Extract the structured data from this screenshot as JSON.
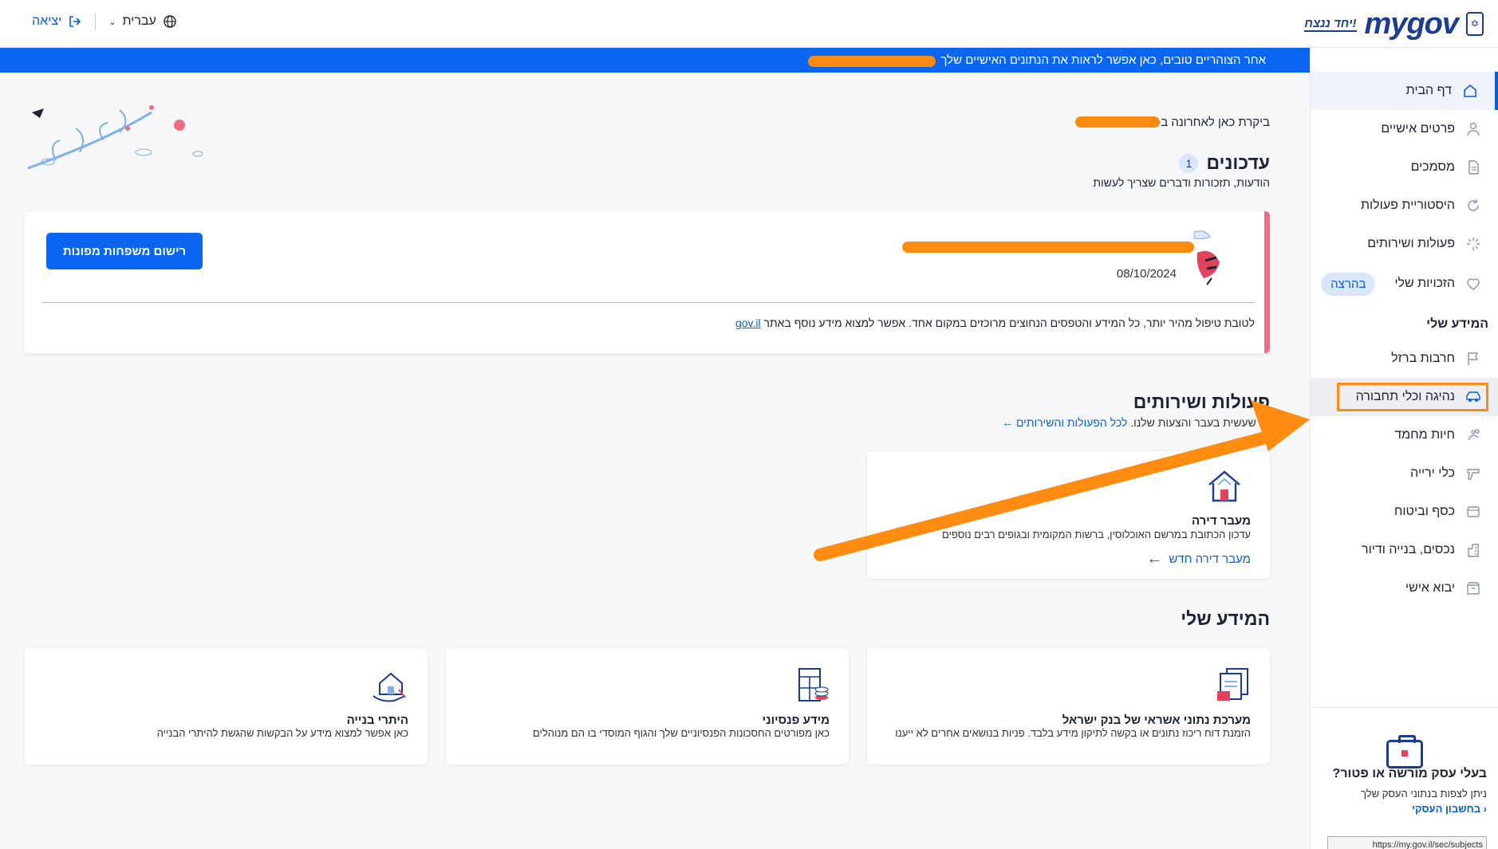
{
  "header": {
    "logo_text": "mygov",
    "slogan": "יחד ננצח!",
    "exit_label": "יציאה",
    "language_label": "עברית"
  },
  "banner": {
    "text": "אחר הצוהריים טובים,  כאן אפשר לראות את הנתונים האישיים שלך"
  },
  "sidebar": {
    "items": [
      {
        "label": "דף הבית",
        "icon": "home-icon"
      },
      {
        "label": "פרטים אישיים",
        "icon": "person-icon"
      },
      {
        "label": "מסמכים",
        "icon": "document-icon"
      },
      {
        "label": "היסטוריית פעולות",
        "icon": "history-icon"
      },
      {
        "label": "פעולות ושירותים",
        "icon": "services-icon"
      },
      {
        "label": "הזכויות שלי",
        "icon": "heart-icon",
        "tag": "בהרצה"
      }
    ],
    "section_title": "המידע שלי",
    "info_items": [
      {
        "label": "חרבות ברזל",
        "icon": "flag-icon"
      },
      {
        "label": "נהיגה וכלי תחבורה",
        "icon": "car-icon"
      },
      {
        "label": "חיות מחמד",
        "icon": "pet-icon"
      },
      {
        "label": "כלי ירייה",
        "icon": "gun-icon"
      },
      {
        "label": "כסף וביטוח",
        "icon": "money-icon"
      },
      {
        "label": "נכסים, בנייה ודיור",
        "icon": "building-icon"
      },
      {
        "label": "יבוא אישי",
        "icon": "package-icon"
      }
    ],
    "promo": {
      "title": "בעלי עסק מורשה או פטור?",
      "text": "ניתן לצפות בנתוני העסק שלך",
      "link": "בחשבון העסקי",
      "url": "https://my.gov.il/sec/subjects"
    }
  },
  "main": {
    "last_visit": "ביקרת כאן לאחרונה ב-",
    "updates": {
      "title": "עדכונים",
      "count": "1",
      "subtitle": "הודעות, תזכורות ודברים שצריך לעשות",
      "card": {
        "date": "08/10/2024",
        "button": "רישום משפחות מפונות",
        "info_text": "לטובת טיפול מהיר יותר, כל המידע והטפסים הנחוצים מרוכזים במקום אחד. אפשר למצוא מידע נוסף באתר",
        "info_link": "gov.il"
      }
    },
    "services": {
      "title": "פעולות ושירותים",
      "subtitle": "ות שעשית בעבר והצעות שלנו.",
      "all_link": "לכל הפעולות והשירותים",
      "card": {
        "title": "מעבר דירה",
        "desc": "עדכון הכתובת במרשם האוכלוסין, ברשות המקומית ובגופים רבים נוספים",
        "link": "מעבר דירה חדש"
      }
    },
    "my_info": {
      "title": "המידע שלי",
      "cards": [
        {
          "title": "מערכת נתוני אשראי של בנק ישראל",
          "desc": "הזמנת דוח ריכוז נתונים או בקשה לתיקון מידע בלבד. פניות בנושאים אחרים לא ייענו"
        },
        {
          "title": "מידע פנסיוני",
          "desc": "כאן מפורטים החסכונות הפנסיוניים שלך והגוף המוסדי בו הם מנוהלים"
        },
        {
          "title": "היתרי בנייה",
          "desc": "כאן אפשר למצוא מידע על הבקשות שהגשת להיתרי הבנייה"
        }
      ]
    }
  },
  "colors": {
    "primary": "#0a66f0",
    "brand_dark": "#1d3b8f",
    "annotation": "#ff8c10",
    "alert": "#f06b84"
  }
}
